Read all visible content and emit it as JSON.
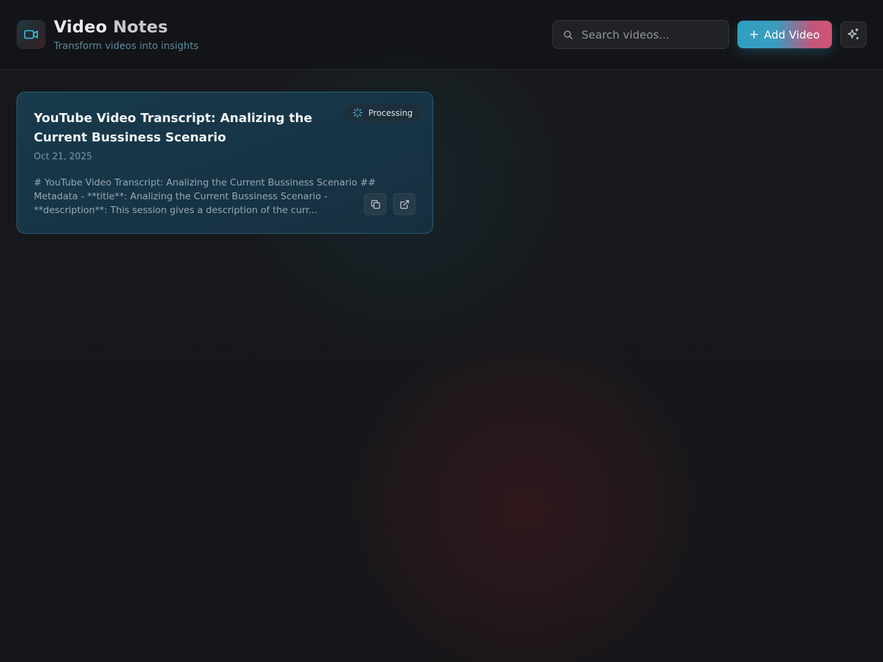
{
  "header": {
    "title_part1": "Video",
    "title_part2": "Notes",
    "subtitle": "Transform videos into insights",
    "logo_icon": "video-camera-icon"
  },
  "search": {
    "placeholder": "Search videos...",
    "value": "",
    "icon": "search-icon"
  },
  "actions": {
    "add_video_label": "Add Video",
    "add_icon": "plus-icon",
    "magic_icon": "sparkles-icon"
  },
  "videos": [
    {
      "title": "YouTube Video Transcript: Analizing the Current Bussiness Scenario",
      "date": "Oct 21, 2025",
      "status": "Processing",
      "status_icon": "spinner-icon",
      "excerpt": "# YouTube Video Transcript: Analizing the Current Bussiness Scenario ## Metadata - **title**: Analizing the Current Bussiness Scenario - **description**: This session gives a description of the curr...",
      "copy_icon": "copy-icon",
      "open_icon": "external-link-icon"
    }
  ],
  "colors": {
    "accent_teal": "#2fa0c2",
    "accent_pink": "#cf5474",
    "card_bg": "#173547",
    "card_border": "#2c5f73",
    "page_bg": "#17181c"
  }
}
